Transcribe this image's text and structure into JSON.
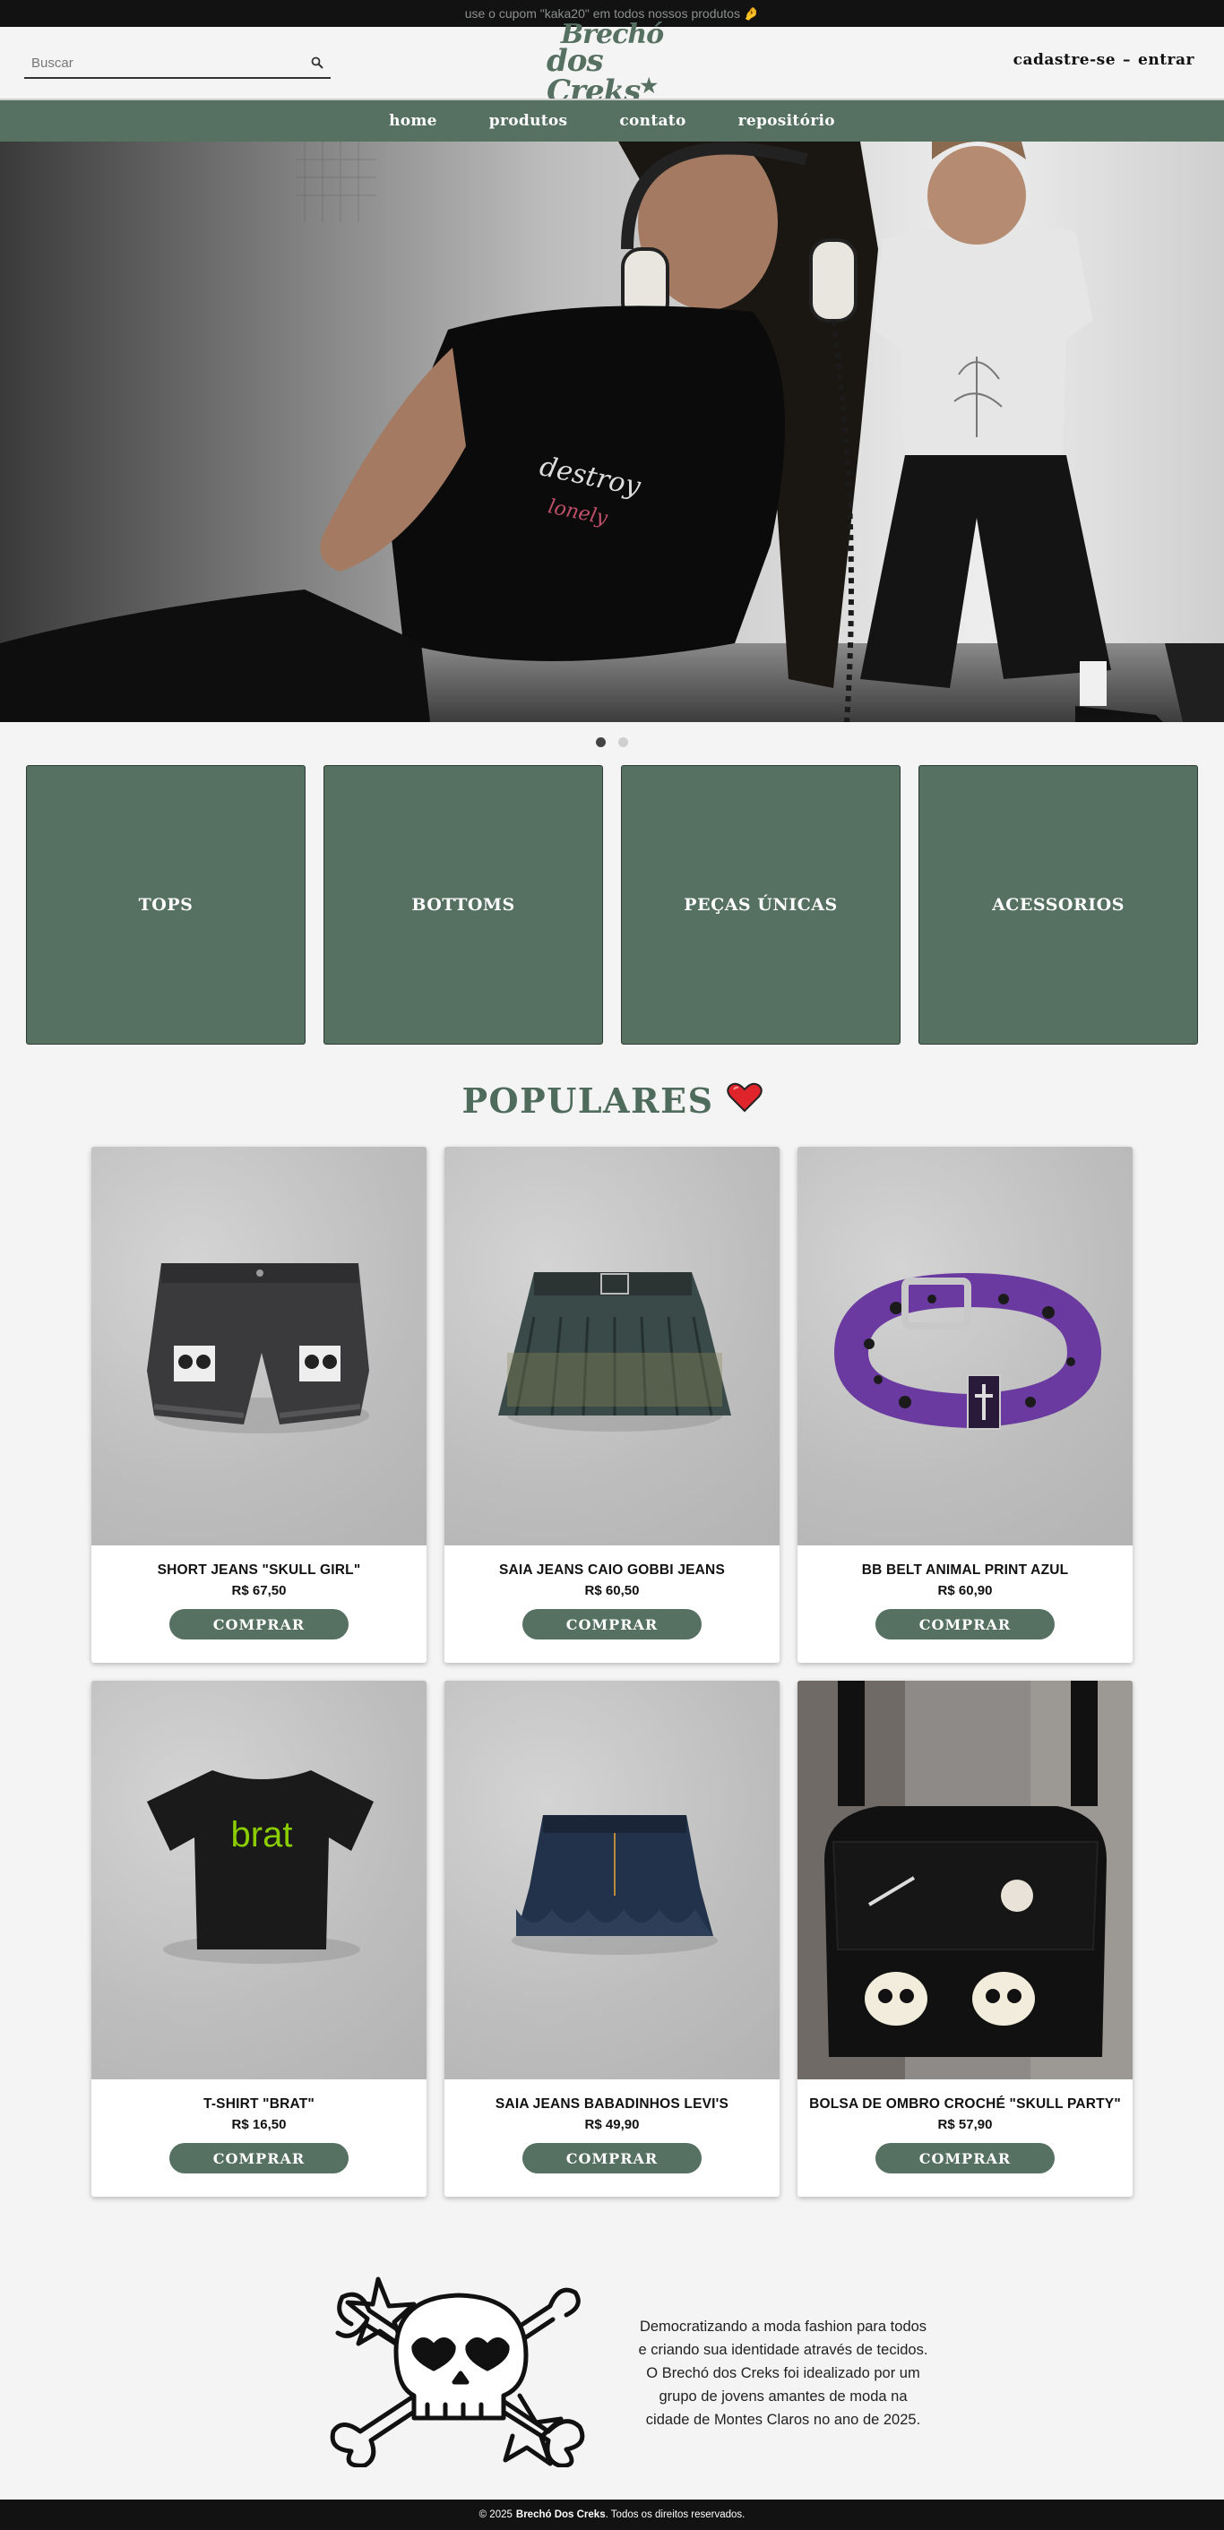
{
  "topbar": {
    "promo_text": "use o cupom \"kaka20\" em todos nossos produtos 🤌"
  },
  "header": {
    "search_placeholder": "Buscar",
    "logo_line1": "Brechó",
    "logo_line2": "dos Creks",
    "signup_label": "cadastre-se",
    "separator": "–",
    "login_label": "entrar"
  },
  "nav": {
    "items": [
      {
        "label": "home"
      },
      {
        "label": "produtos"
      },
      {
        "label": "contato"
      },
      {
        "label": "repositório"
      }
    ]
  },
  "carousel": {
    "slide_count": 2,
    "active_index": 0
  },
  "categories": [
    {
      "label": "TOPS"
    },
    {
      "label": "BOTTOMS"
    },
    {
      "label": "PEÇAS ÚNICAS"
    },
    {
      "label": "ACESSORIOS"
    }
  ],
  "popular": {
    "title": "POPULARES",
    "icon": "heart-icon"
  },
  "products": [
    {
      "name": "SHORT JEANS \"SKULL GIRL\"",
      "price": "R$ 67,50",
      "button": "COMPRAR",
      "image": "denim-shorts"
    },
    {
      "name": "SAIA JEANS CAIO GOBBI JEANS",
      "price": "R$ 60,50",
      "button": "COMPRAR",
      "image": "denim-skirt"
    },
    {
      "name": "BB BELT ANIMAL PRINT AZUL",
      "price": "R$ 60,90",
      "button": "COMPRAR",
      "image": "belt"
    },
    {
      "name": "T-SHIRT \"BRAT\"",
      "price": "R$ 16,50",
      "button": "COMPRAR",
      "image": "tshirt",
      "print": "brat"
    },
    {
      "name": "SAIA JEANS BABADINHOS LEVI'S",
      "price": "R$ 49,90",
      "button": "COMPRAR",
      "image": "mini-skirt"
    },
    {
      "name": "BOLSA DE OMBRO CROCHÉ \"SKULL PARTY\"",
      "price": "R$ 57,90",
      "button": "COMPRAR",
      "image": "crochet-bag"
    }
  ],
  "about": {
    "lines": [
      "Democratizando a moda fashion para todos",
      "e criando sua identidade através de tecidos.",
      "O Brechó dos Creks foi idealizado por um",
      "grupo de jovens amantes de moda na",
      "cidade de Montes Claros no ano de 2025."
    ]
  },
  "footer": {
    "prefix": "© 2025",
    "brand": "Brechó Dos Creks",
    "suffix": ". Todos os direitos reservados."
  },
  "colors": {
    "accent": "#567062",
    "dark": "#121212",
    "background": "#f4f4f4"
  }
}
